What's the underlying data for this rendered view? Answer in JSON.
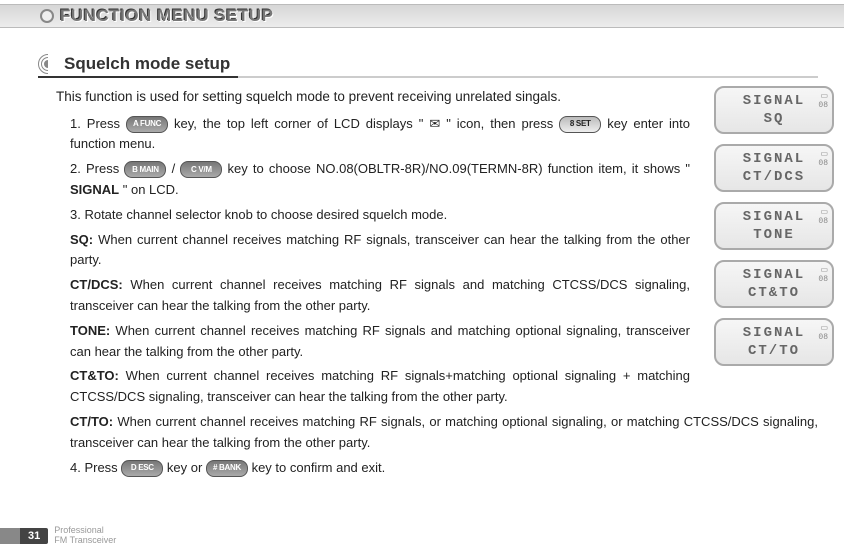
{
  "page_title": "FUNCTION MENU SETUP",
  "section_title": "Squelch mode setup",
  "intro": "This function is used for setting squelch mode to prevent receiving unrelated singals.",
  "steps": {
    "s1a": "1. Press ",
    "s1_key1": "A FUNC",
    "s1b": " key, the top left corner of LCD displays \"",
    "s1c": "\" icon, then press ",
    "s1_key2": "8 SET",
    "s1d": " key enter into function menu.",
    "s2a": "2. Press ",
    "s2_key1": "B MAIN",
    "s2_slash": " / ",
    "s2_key2": "C V/M",
    "s2b": "  key to choose NO.08(OBLTR-8R)/NO.09(TERMN-8R) function item, it shows \"",
    "s2_signal": "SIGNAL",
    "s2c": "\" on LCD.",
    "s3": "3. Rotate channel selector knob to choose desired squelch mode.",
    "mode_sq_label": "SQ:",
    "mode_sq_text": " When current channel receives matching RF signals, transceiver can hear the talking from the other party.",
    "mode_ctdcs_label": "CT/DCS:",
    "mode_ctdcs_text": " When current channel receives matching RF signals and matching CTCSS/DCS signaling, transceiver can hear the talking from the other party.",
    "mode_tone_label": "TONE:",
    "mode_tone_text": " When current channel receives matching RF signals and matching optional signaling, transceiver can hear the talking from the other party.",
    "mode_ctto_label": "CT&TO:",
    "mode_ctto_text": " When current channel receives matching RF signals+matching optional signaling + matching CTCSS/DCS signaling, transceiver can hear the talking from the other party.",
    "mode_ctorto_label": "CT/TO:",
    "mode_ctorto_text": " When current channel receives matching RF signals, or matching optional signaling, or matching CTCSS/DCS signaling, transceiver can hear the talking from the other party.",
    "s4a": "4. Press ",
    "s4_key1": "D ESC",
    "s4b": " key or ",
    "s4_key2": "# BANK",
    "s4c": " key to confirm and exit."
  },
  "lcds": [
    {
      "line1": "SIGNAL",
      "line2": "SQ",
      "num": "08"
    },
    {
      "line1": "SIGNAL",
      "line2": "CT/DCS",
      "num": "08"
    },
    {
      "line1": "SIGNAL",
      "line2": "TONE",
      "num": "08"
    },
    {
      "line1": "SIGNAL",
      "line2": "CT&TO",
      "num": "08"
    },
    {
      "line1": "SIGNAL",
      "line2": "CT/TO",
      "num": "08"
    }
  ],
  "footer": {
    "page_number": "31",
    "tag1": "Professional",
    "tag2": "FM Transceiver"
  }
}
